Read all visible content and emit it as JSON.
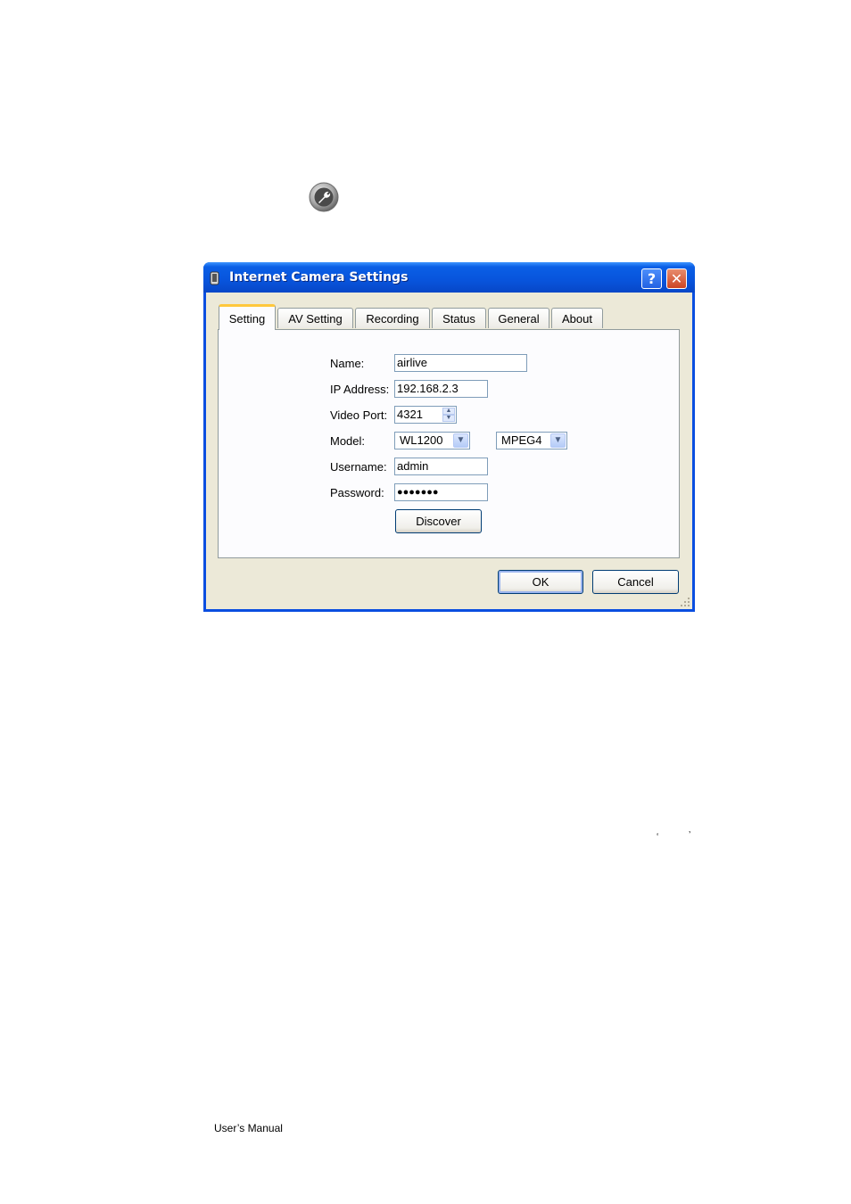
{
  "dialog": {
    "title": "Internet Camera Settings",
    "help_label": "?",
    "close_label": "✕"
  },
  "tabs": [
    {
      "label": "Setting",
      "active": true
    },
    {
      "label": "AV Setting"
    },
    {
      "label": "Recording"
    },
    {
      "label": "Status"
    },
    {
      "label": "General"
    },
    {
      "label": "About"
    }
  ],
  "form": {
    "name_label": "Name:",
    "name_value": "airlive",
    "ip_label": "IP Address:",
    "ip_value": "192.168.2.3",
    "port_label": "Video Port:",
    "port_value": "4321",
    "model_label": "Model:",
    "model_value": "WL1200",
    "codec_value": "MPEG4",
    "username_label": "Username:",
    "username_value": "admin",
    "password_label": "Password:",
    "password_value": "●●●●●●●",
    "discover_label": "Discover"
  },
  "buttons": {
    "ok_label": "OK",
    "cancel_label": "Cancel"
  },
  "page": {
    "open_quote": "‘",
    "close_quote": "’",
    "footer": "User’s Manual"
  },
  "colors": {
    "titlebar": "#0854dc",
    "active_tab_accent": "#ffc83c",
    "dialog_bg": "#ece9d8"
  }
}
